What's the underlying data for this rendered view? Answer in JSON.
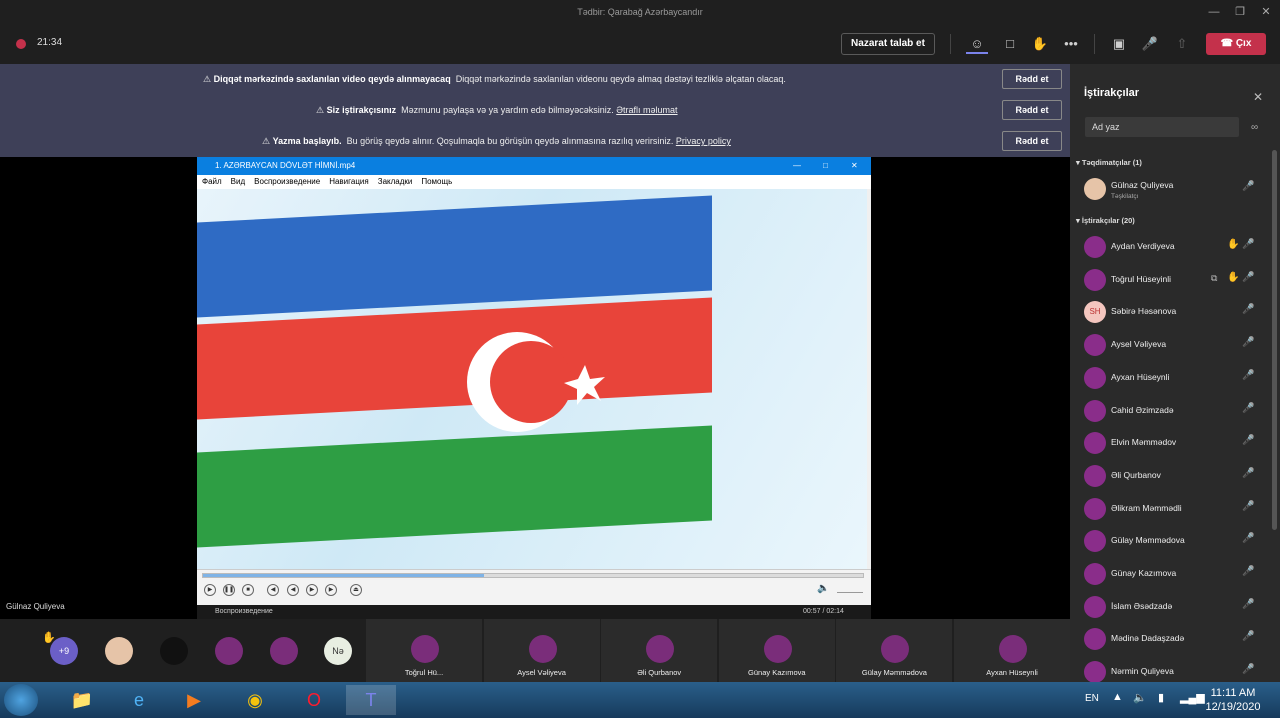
{
  "window": {
    "title": "Tədbir: Qarabağ Azərbaycandır"
  },
  "topbar": {
    "timer": "21:34",
    "request_control_label": "Nazarat talab et",
    "leave_label": "Çıx"
  },
  "banners": [
    {
      "bold": "Diqqət mərkəzində saxlanılan video qeydə alınmayacaq",
      "text": "Diqqət mərkəzində saxlanılan videonu qeydə almaq dəstəyi tezliklə əlçatan olacaq.",
      "link": "",
      "button": "Rədd et"
    },
    {
      "bold": "Siz iştirakçısınız",
      "text": "Məzmunu paylaşa və ya yardım edə bilməyəcəksiniz.",
      "link": "Ətraflı məlumat",
      "button": "Rədd et"
    },
    {
      "bold": "Yazma başlayıb.",
      "text": "Bu görüş qeydə alınır. Qoşulmaqla bu görüşün qeydə alınmasına razılıq verirsiniz.",
      "link": "Privacy policy",
      "button": "Rədd et"
    }
  ],
  "stage": {
    "presenter_name": "Gülnaz Quliyeva"
  },
  "player": {
    "title": "1. AZƏRBAYCAN DÖVLƏT HİMNİ.mp4",
    "menu": [
      "Файл",
      "Вид",
      "Воспроизведение",
      "Навигация",
      "Закладки",
      "Помощь"
    ],
    "status": "Воспроизведение",
    "time": "00:57 / 02:14",
    "progress": 0.425
  },
  "sidebar": {
    "title": "İştirakçılar",
    "search_placeholder": "Ad yaz",
    "presenters_header": "Təqdimatçılar (1)",
    "attendees_header": "İştirakçılar (20)",
    "presenter": {
      "name": "Gülnaz Quliyeva",
      "role": "Təşkilatçı"
    },
    "attendees": [
      {
        "name": "Aydan Verdiyeva",
        "hand": true,
        "share": false,
        "initials": ""
      },
      {
        "name": "Toğrul Hüseyinli",
        "hand": true,
        "share": true,
        "initials": ""
      },
      {
        "name": "Səbirə Həsənova",
        "hand": false,
        "share": false,
        "initials": "SH"
      },
      {
        "name": "Aysel Vəliyeva",
        "hand": false,
        "share": false,
        "initials": ""
      },
      {
        "name": "Ayxan Hüseynli",
        "hand": false,
        "share": false,
        "initials": ""
      },
      {
        "name": "Cahid Əzimzadə",
        "hand": false,
        "share": false,
        "initials": ""
      },
      {
        "name": "Elvin Məmmədov",
        "hand": false,
        "share": false,
        "initials": ""
      },
      {
        "name": "Əli Qurbanov",
        "hand": false,
        "share": false,
        "initials": ""
      },
      {
        "name": "Əlikram Məmmədli",
        "hand": false,
        "share": false,
        "initials": ""
      },
      {
        "name": "Gülay Məmmədova",
        "hand": false,
        "share": false,
        "initials": ""
      },
      {
        "name": "Günay Kazımova",
        "hand": false,
        "share": false,
        "initials": ""
      },
      {
        "name": "İslam Əsədzadə",
        "hand": false,
        "share": false,
        "initials": ""
      },
      {
        "name": "Mədinə Dadaşzadə",
        "hand": false,
        "share": false,
        "initials": ""
      },
      {
        "name": "Nərmin Quliyeva",
        "hand": false,
        "share": false,
        "initials": ""
      }
    ]
  },
  "strip": {
    "overflow_label": "+9",
    "initials_avatar": "Nə",
    "tiles": [
      "Toğrul Hü...",
      "Aysel Vəliyeva",
      "Əli Qurbanov",
      "Günay Kazımova",
      "Gülay Məmmədova",
      "Ayxan Hüseynli"
    ]
  },
  "taskbar": {
    "lang": "EN",
    "time": "11:11 AM",
    "date": "12/19/2020"
  },
  "colors": {
    "accent_red": "#c4314b",
    "banner_bg": "#3e4058",
    "flag_blue": "#2f6bc4",
    "flag_red": "#e8443a",
    "flag_green": "#2e9e44"
  }
}
